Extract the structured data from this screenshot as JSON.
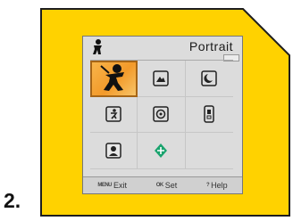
{
  "step": {
    "label": "2."
  },
  "screen": {
    "mode_name": "Portrait",
    "header_icon": "portrait-mode-icon",
    "grid": [
      {
        "icon": "portrait-icon",
        "selected": true
      },
      {
        "icon": "landscape-icon",
        "selected": false
      },
      {
        "icon": "night-portrait-icon",
        "selected": false
      },
      {
        "icon": "sports-icon",
        "selected": false
      },
      {
        "icon": "macro-icon",
        "selected": false
      },
      {
        "icon": "night-landscape-icon",
        "selected": false
      },
      {
        "icon": "self-portrait-icon",
        "selected": false
      },
      {
        "icon": "scene-assist-icon",
        "selected": false
      },
      {
        "icon": "empty",
        "selected": false
      }
    ],
    "footer": {
      "exit_button": "MENU",
      "exit_label": "Exit",
      "set_button": "OK",
      "set_label": "Set",
      "help_button": "?",
      "help_label": "Help"
    }
  },
  "colors": {
    "card_yellow": "#ffd200",
    "card_border": "#1e1e1e",
    "screen_bg": "#dcdcdc",
    "selected_orange": "#f39a2a"
  }
}
